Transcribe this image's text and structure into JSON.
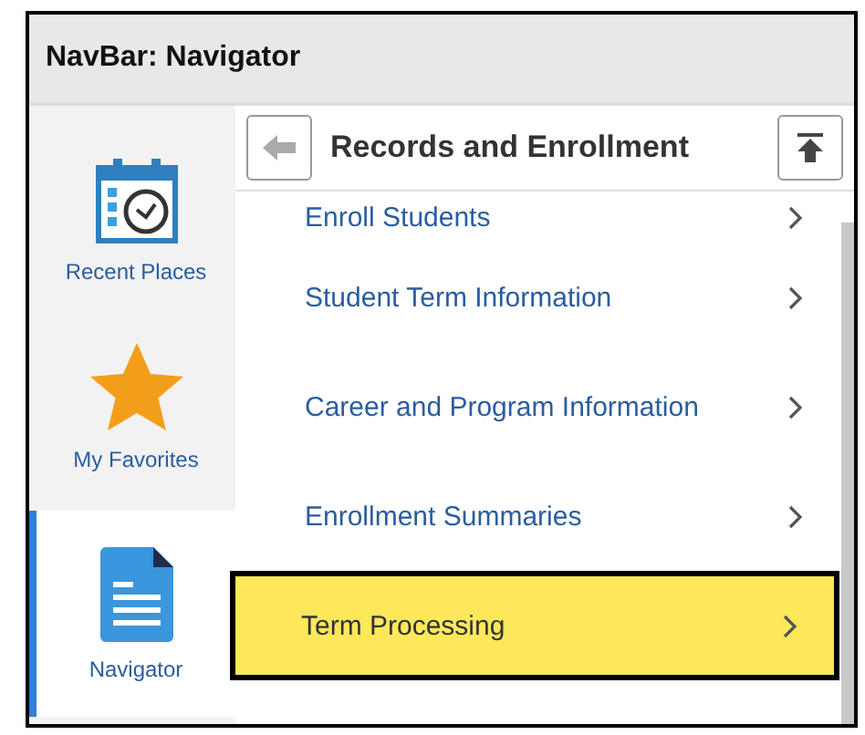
{
  "header": {
    "title": "NavBar: Navigator"
  },
  "sidebar": {
    "items": [
      {
        "label": "Recent Places",
        "kind": "calendar",
        "selected": false
      },
      {
        "label": "My Favorites",
        "kind": "star",
        "selected": false
      },
      {
        "label": "Navigator",
        "kind": "document",
        "selected": true
      }
    ]
  },
  "panel": {
    "title": "Records and Enrollment",
    "items": [
      {
        "label": "Enroll Students",
        "selected": false
      },
      {
        "label": "Student Term Information",
        "selected": false
      },
      {
        "label": "Career and Program Information",
        "selected": false
      },
      {
        "label": "Enrollment Summaries",
        "selected": false
      },
      {
        "label": "Term Processing",
        "selected": true
      }
    ]
  }
}
